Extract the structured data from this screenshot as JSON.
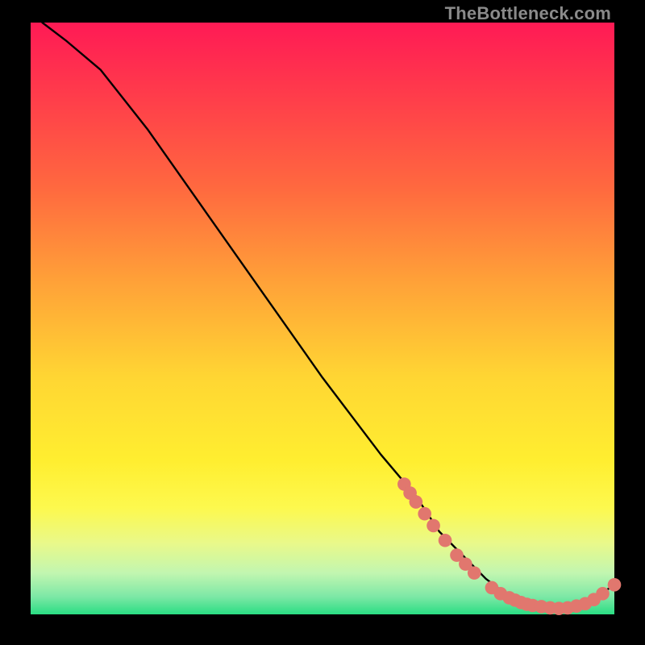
{
  "watermark": "TheBottleneck.com",
  "colors": {
    "bg": "#000000",
    "dot": "#e1776e",
    "curve": "#000000",
    "gradient_stops": [
      {
        "pct": 0,
        "hex": "#ff1a55"
      },
      {
        "pct": 12,
        "hex": "#ff3b4b"
      },
      {
        "pct": 28,
        "hex": "#ff693f"
      },
      {
        "pct": 44,
        "hex": "#ffa238"
      },
      {
        "pct": 60,
        "hex": "#ffd633"
      },
      {
        "pct": 74,
        "hex": "#ffee30"
      },
      {
        "pct": 82,
        "hex": "#fdf94e"
      },
      {
        "pct": 88,
        "hex": "#e9f98a"
      },
      {
        "pct": 93,
        "hex": "#c2f6b0"
      },
      {
        "pct": 97,
        "hex": "#7de8a6"
      },
      {
        "pct": 100,
        "hex": "#2add83"
      }
    ]
  },
  "chart_data": {
    "type": "line",
    "title": "",
    "xlabel": "",
    "ylabel": "",
    "xlim": [
      0,
      100
    ],
    "ylim": [
      0,
      100
    ],
    "series": [
      {
        "name": "bottleneck-curve",
        "points": [
          {
            "x": 2,
            "y": 100
          },
          {
            "x": 6,
            "y": 97
          },
          {
            "x": 12,
            "y": 92
          },
          {
            "x": 20,
            "y": 82
          },
          {
            "x": 30,
            "y": 68
          },
          {
            "x": 40,
            "y": 54
          },
          {
            "x": 50,
            "y": 40
          },
          {
            "x": 60,
            "y": 27
          },
          {
            "x": 66,
            "y": 20
          },
          {
            "x": 70,
            "y": 14
          },
          {
            "x": 74,
            "y": 10
          },
          {
            "x": 78,
            "y": 6
          },
          {
            "x": 82,
            "y": 3
          },
          {
            "x": 86,
            "y": 1.5
          },
          {
            "x": 90,
            "y": 1
          },
          {
            "x": 94,
            "y": 1.5
          },
          {
            "x": 97,
            "y": 3
          },
          {
            "x": 100,
            "y": 5
          }
        ]
      }
    ],
    "markers": [
      {
        "x": 64,
        "y": 22
      },
      {
        "x": 65,
        "y": 20.5
      },
      {
        "x": 66,
        "y": 19
      },
      {
        "x": 67.5,
        "y": 17
      },
      {
        "x": 69,
        "y": 15
      },
      {
        "x": 71,
        "y": 12.5
      },
      {
        "x": 73,
        "y": 10
      },
      {
        "x": 74.5,
        "y": 8.5
      },
      {
        "x": 76,
        "y": 7
      },
      {
        "x": 79,
        "y": 4.5
      },
      {
        "x": 80.5,
        "y": 3.5
      },
      {
        "x": 82,
        "y": 2.8
      },
      {
        "x": 83,
        "y": 2.4
      },
      {
        "x": 84,
        "y": 2.0
      },
      {
        "x": 85,
        "y": 1.7
      },
      {
        "x": 86,
        "y": 1.5
      },
      {
        "x": 87.5,
        "y": 1.3
      },
      {
        "x": 89,
        "y": 1.1
      },
      {
        "x": 90.5,
        "y": 1.0
      },
      {
        "x": 92,
        "y": 1.1
      },
      {
        "x": 93.5,
        "y": 1.4
      },
      {
        "x": 95,
        "y": 1.8
      },
      {
        "x": 96.5,
        "y": 2.5
      },
      {
        "x": 98,
        "y": 3.5
      },
      {
        "x": 100,
        "y": 5
      }
    ]
  }
}
